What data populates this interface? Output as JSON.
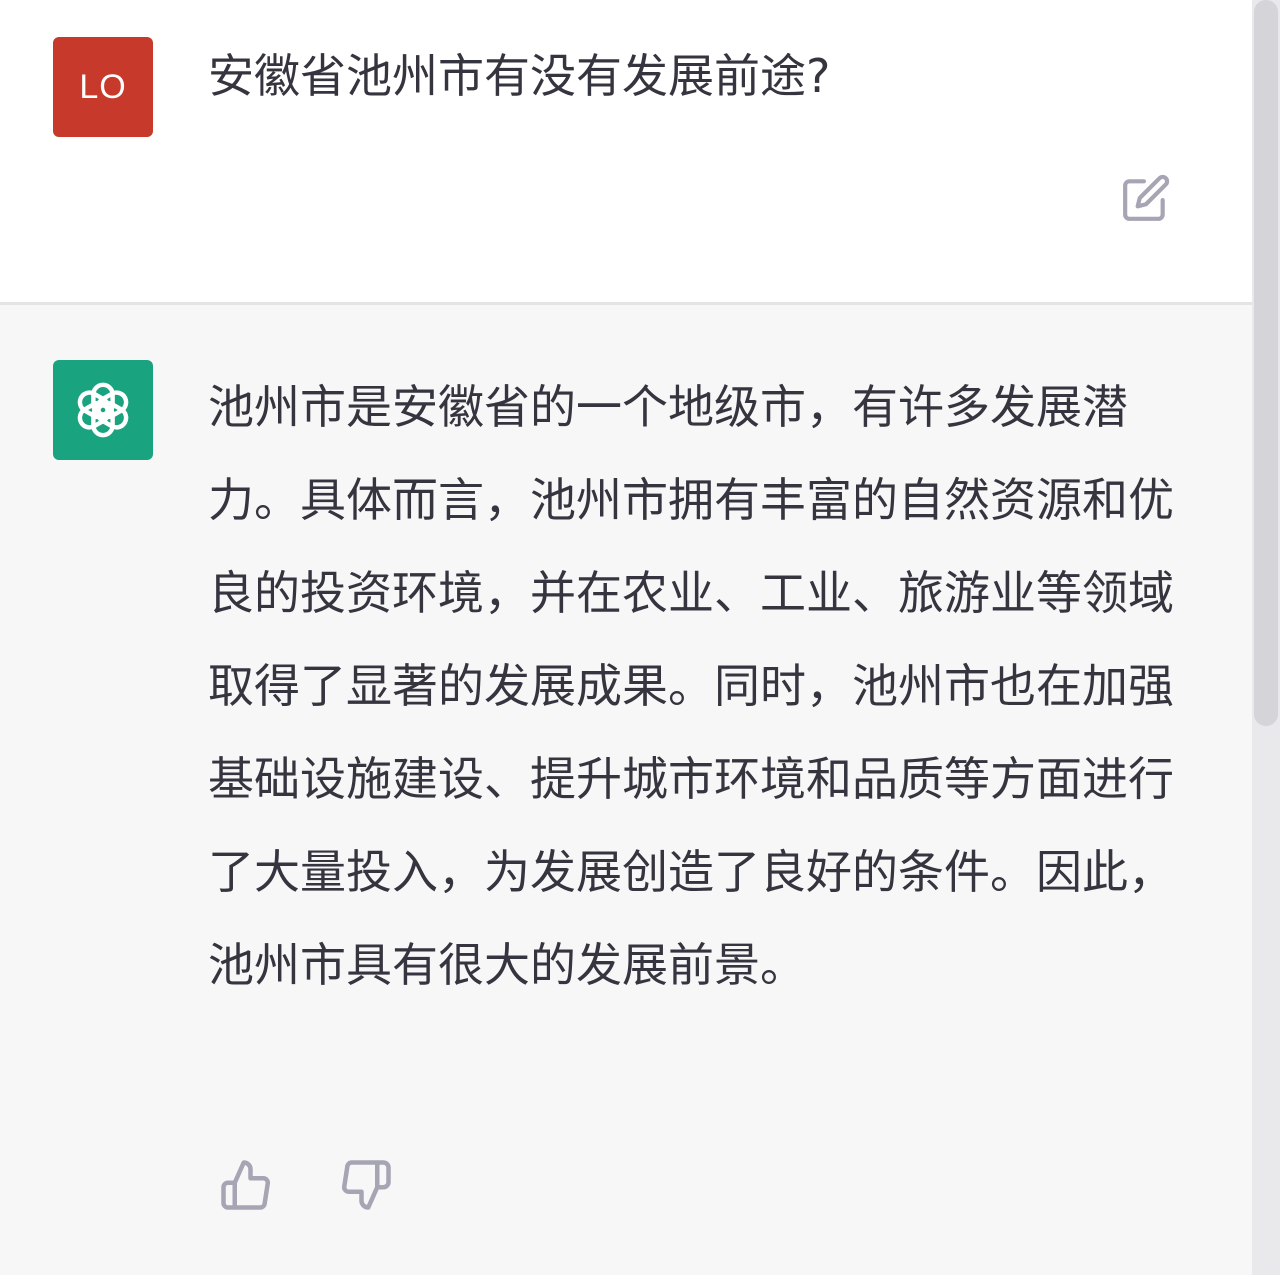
{
  "user_message": {
    "avatar_initials": "LO",
    "text": "安徽省池州市有没有发展前途?",
    "edit_icon": "edit-icon"
  },
  "assistant_message": {
    "avatar_icon": "openai-logo-icon",
    "text": "池州市是安徽省的一个地级市，有许多发展潜力。具体而言，池州市拥有丰富的自然资源和优良的投资环境，并在农业、工业、旅游业等领域取得了显著的发展成果。同时，池州市也在加强基础设施建设、提升城市环境和品质等方面进行了大量投入，为发展创造了良好的条件。因此，池州市具有很大的发展前景。",
    "feedback_icons": [
      "thumbs-up-icon",
      "thumbs-down-icon"
    ]
  },
  "colors": {
    "user_avatar": "#c7392b",
    "bot_avatar": "#19a37f",
    "text": "#35353f",
    "icon": "#a5a5b4"
  }
}
